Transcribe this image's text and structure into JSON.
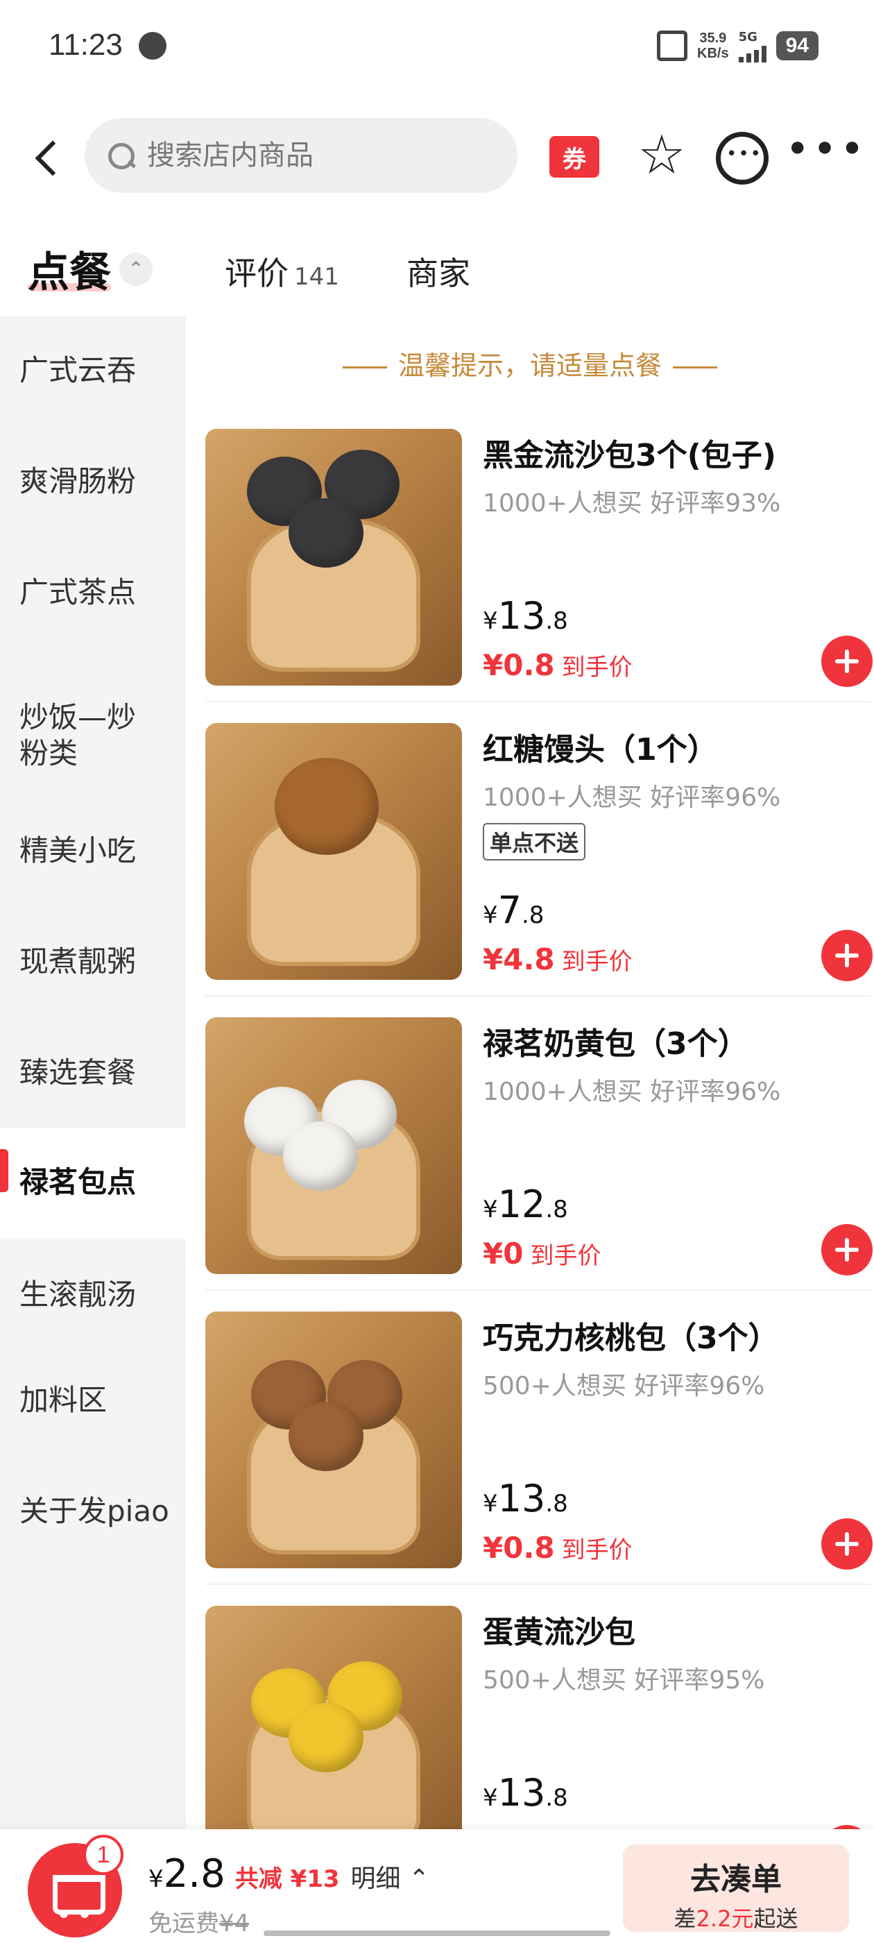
{
  "status_bar": {
    "time": "11:23",
    "net_speed_value": "35.9",
    "net_speed_unit": "KB/s",
    "network": "5G",
    "battery": "94"
  },
  "header": {
    "search_placeholder": "搜索店内商品",
    "coupon_label": "券"
  },
  "tabs": {
    "order": "点餐",
    "review": "评价",
    "review_count": "141",
    "merchant": "商家"
  },
  "sidebar": {
    "items": [
      {
        "label": "广式云吞"
      },
      {
        "label": "爽滑肠粉"
      },
      {
        "label": "广式茶点"
      },
      {
        "label": "炒饭—炒粉类"
      },
      {
        "label": "精美小吃"
      },
      {
        "label": "现煮靓粥"
      },
      {
        "label": "臻选套餐"
      },
      {
        "label": "禄茗包点"
      },
      {
        "label": "生滚靓汤"
      },
      {
        "label": "加料区"
      },
      {
        "label": "关于发piao"
      }
    ],
    "active_index": 7
  },
  "main": {
    "tip": "温馨提示，请适量点餐",
    "items": [
      {
        "name": "黑金流沙包3个(包子)",
        "stats": "1000+人想买  好评率93%",
        "tag": "",
        "price_cur": "¥",
        "price_int": "13",
        "price_dec": ".8",
        "hand_price": "¥0.8",
        "hand_label": "到手价",
        "bun_color": "#3a3a3c"
      },
      {
        "name": "红糖馒头（1个）",
        "stats": "1000+人想买  好评率96%",
        "tag": "单点不送",
        "price_cur": "¥",
        "price_int": "7",
        "price_dec": ".8",
        "hand_price": "¥4.8",
        "hand_label": "到手价",
        "bun_color": "#a5672e"
      },
      {
        "name": "禄茗奶黄包（3个）",
        "stats": "1000+人想买  好评率96%",
        "tag": "",
        "price_cur": "¥",
        "price_int": "12",
        "price_dec": ".8",
        "hand_price": "¥0",
        "hand_label": "到手价",
        "bun_color": "#f4f2ee"
      },
      {
        "name": "巧克力核桃包（3个）",
        "stats": "500+人想买  好评率96%",
        "tag": "",
        "price_cur": "¥",
        "price_int": "13",
        "price_dec": ".8",
        "hand_price": "¥0.8",
        "hand_label": "到手价",
        "bun_color": "#9b6236"
      },
      {
        "name": "蛋黄流沙包",
        "stats": "500+人想买  好评率95%",
        "tag": "",
        "price_cur": "¥",
        "price_int": "13",
        "price_dec": ".8",
        "hand_price": "",
        "hand_label": "",
        "bun_color": "#f2c52e"
      }
    ]
  },
  "bottom_bar": {
    "cart_count": "1",
    "total_cur": "¥",
    "total_value": "2.8",
    "discount": "共减 ¥13",
    "detail": "明细 ⌃",
    "delivery_label": "免运费",
    "delivery_old": "¥4",
    "go_label": "去凑单",
    "go_sub_prefix": "差",
    "go_sub_amount": "2.2元",
    "go_sub_suffix": "起送"
  },
  "colors": {
    "accent": "#f0343b",
    "tip": "#c58a3a",
    "sidebar_bg": "#f4f4f6"
  }
}
